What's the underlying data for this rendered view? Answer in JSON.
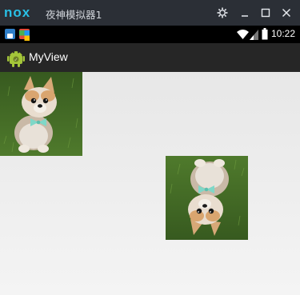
{
  "window": {
    "brand": "nox",
    "title": "夜神模拟器1",
    "controls": [
      "settings-icon",
      "minimize-icon",
      "maximize-icon",
      "close-icon"
    ]
  },
  "statusbar": {
    "time": "10:22",
    "icons": [
      "notification-app-icon",
      "notification-photo-icon",
      "wifi-icon",
      "signal-icon",
      "battery-icon"
    ]
  },
  "actionbar": {
    "app_icon": "android-icon",
    "title": "MyView"
  },
  "content": {
    "images": [
      {
        "subject": "pomeranian-puppy",
        "orientation": "upright"
      },
      {
        "subject": "pomeranian-puppy",
        "orientation": "rotated-180"
      }
    ]
  },
  "colors": {
    "titlebar": "#2b2f36",
    "nox_brand": "#29c0e6",
    "statusbar": "#000000",
    "actionbar": "#262626",
    "content_bg": "#efefef"
  }
}
